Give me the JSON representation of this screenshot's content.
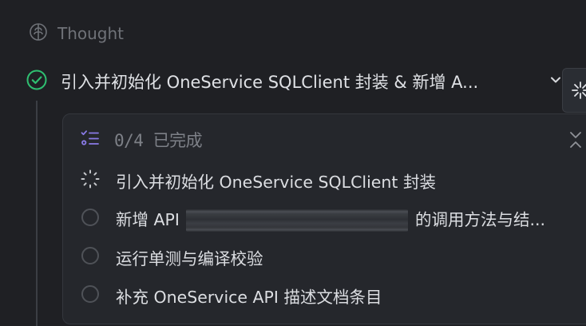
{
  "thought": {
    "label": "Thought"
  },
  "task": {
    "title": "引入并初始化 OneService SQLClient 封装 & 新增 A..."
  },
  "todo": {
    "progress": "0/4",
    "progress_suffix": "已完成",
    "items": [
      {
        "label": "引入并初始化 OneService SQLClient 封装",
        "status": "in-progress"
      },
      {
        "label_prefix": "新增 API",
        "label_suffix": "的调用方法与结...",
        "status": "pending"
      },
      {
        "label": "运行单测与编译校验",
        "status": "pending"
      },
      {
        "label": "补充 OneService API 描述文档条目",
        "status": "pending"
      }
    ]
  },
  "colors": {
    "accent_green": "#2fbf71",
    "accent_purple": "#8a7be8",
    "background": "#1f2024",
    "panel": "#25272c"
  }
}
